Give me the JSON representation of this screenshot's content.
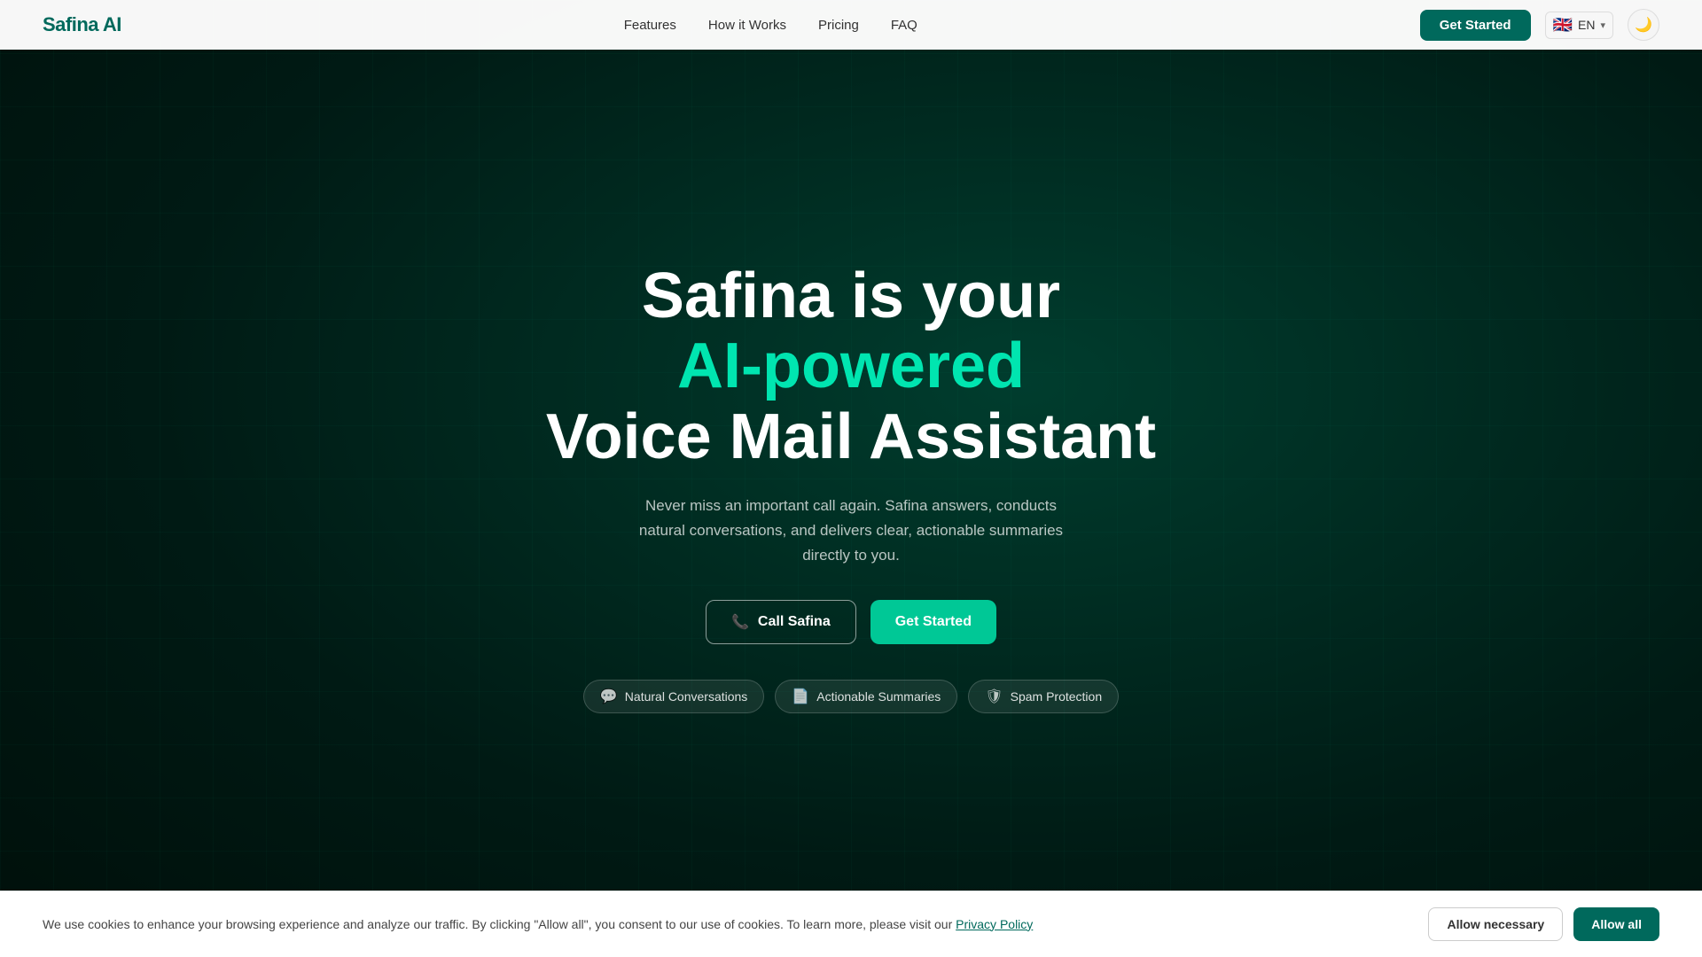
{
  "nav": {
    "logo": "Safina AI",
    "links": [
      {
        "label": "Features",
        "id": "features"
      },
      {
        "label": "How it Works",
        "id": "how-it-works"
      },
      {
        "label": "Pricing",
        "id": "pricing"
      },
      {
        "label": "FAQ",
        "id": "faq"
      }
    ],
    "cta_label": "Get Started",
    "lang": {
      "code": "EN",
      "flag": "🇬🇧",
      "chevron": "▾"
    },
    "dark_mode_icon": "🌙"
  },
  "hero": {
    "line1": "Safina is your",
    "line2": "AI-powered",
    "line3": "Voice Mail Assistant",
    "description": "Never miss an important call again. Safina answers, conducts natural conversations, and delivers clear, actionable summaries directly to you.",
    "btn_call": "Call Safina",
    "btn_get_started": "Get Started"
  },
  "pills": [
    {
      "label": "Natural Conversations",
      "icon": "💬"
    },
    {
      "label": "Actionable Summaries",
      "icon": "📄"
    },
    {
      "label": "Spam Protection",
      "icon": "🛡"
    }
  ],
  "cookie": {
    "text": "We use cookies to enhance your browsing experience and analyze our traffic. By clicking \"Allow all\", you consent to our use of cookies. To learn more, please visit our ",
    "privacy_link": "Privacy Policy",
    "btn_necessary": "Allow necessary",
    "btn_all": "Allow all"
  }
}
